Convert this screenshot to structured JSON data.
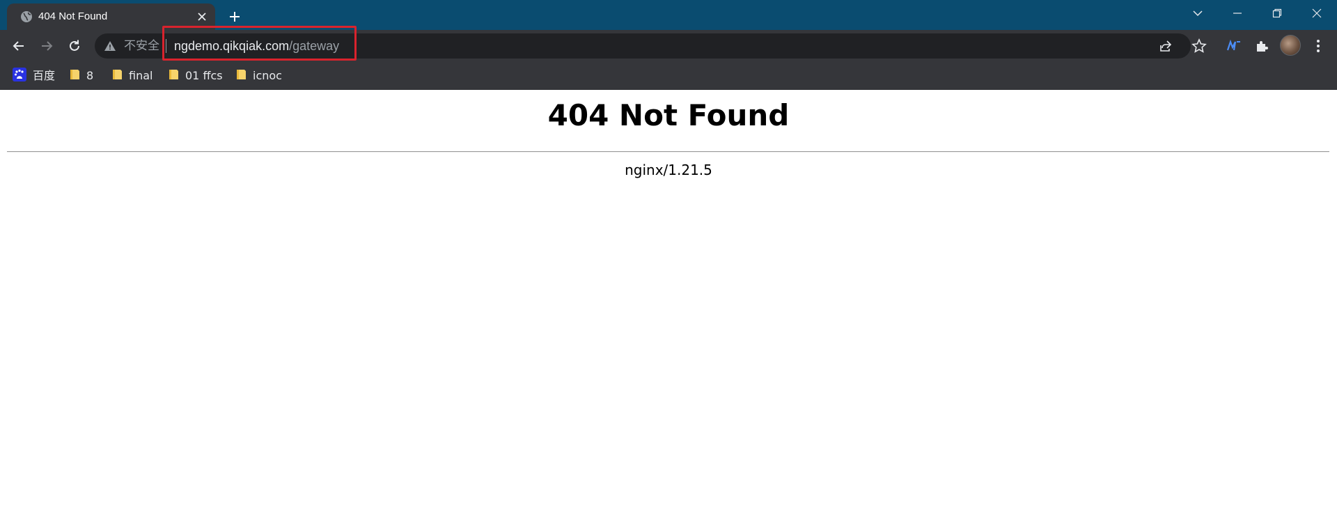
{
  "browser": {
    "tab": {
      "title": "404 Not Found"
    },
    "address_bar": {
      "security_label": "不安全",
      "url_host": "ngdemo.qikqiak.com",
      "url_path": "/gateway"
    },
    "bookmarks": [
      {
        "label": "百度",
        "icon": "baidu-icon"
      },
      {
        "label": "8",
        "icon": "folder-icon"
      },
      {
        "label": "final",
        "icon": "folder-icon"
      },
      {
        "label": "01 ffcs",
        "icon": "folder-icon"
      },
      {
        "label": "icnoc",
        "icon": "folder-icon"
      }
    ],
    "colors": {
      "titlebar": "#0a4c70",
      "toolbar": "#35363a",
      "omnibox": "#202124",
      "highlight": "#d9232d"
    }
  },
  "page": {
    "heading": "404 Not Found",
    "server": "nginx/1.21.5"
  }
}
